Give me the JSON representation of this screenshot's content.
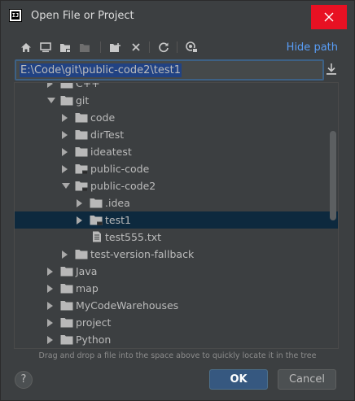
{
  "window": {
    "title": "Open File or Project",
    "app_icon_text": "IJ"
  },
  "toolbar": {
    "icons": [
      "home-icon",
      "desktop-icon",
      "project-folder-icon",
      "module-folder-icon",
      "new-folder-icon",
      "delete-icon",
      "refresh-icon",
      "show-hidden-icon"
    ],
    "hide_path_label": "Hide path"
  },
  "path_field": {
    "value": "E:\\Code\\git\\public-code2\\test1"
  },
  "tree": {
    "rows": [
      {
        "label": "C++",
        "expanded": false,
        "kind": "folder"
      },
      {
        "label": "git",
        "expanded": true,
        "kind": "folder"
      },
      {
        "label": "code",
        "expanded": false,
        "kind": "folder"
      },
      {
        "label": "dirTest",
        "expanded": false,
        "kind": "folder"
      },
      {
        "label": "ideatest",
        "expanded": false,
        "kind": "folder"
      },
      {
        "label": "public-code",
        "expanded": false,
        "kind": "module-folder"
      },
      {
        "label": "public-code2",
        "expanded": true,
        "kind": "module-folder"
      },
      {
        "label": ".idea",
        "expanded": false,
        "kind": "folder"
      },
      {
        "label": "test1",
        "expanded": false,
        "kind": "module-folder",
        "selected": true
      },
      {
        "label": "test555.txt",
        "kind": "file"
      },
      {
        "label": "test-version-fallback",
        "expanded": false,
        "kind": "folder"
      },
      {
        "label": "Java",
        "expanded": false,
        "kind": "folder"
      },
      {
        "label": "map",
        "expanded": false,
        "kind": "folder"
      },
      {
        "label": "MyCodeWarehouses",
        "expanded": false,
        "kind": "folder"
      },
      {
        "label": "project",
        "expanded": false,
        "kind": "folder"
      },
      {
        "label": "Python",
        "expanded": false,
        "kind": "folder"
      }
    ]
  },
  "hint": "Drag and drop a file into the space above to quickly locate it in the tree",
  "buttons": {
    "help": "?",
    "ok": "OK",
    "cancel": "Cancel"
  },
  "colors": {
    "accent_link": "#589df6",
    "selection": "#0d293e",
    "ok_button": "#365880",
    "close_button": "#e81123"
  }
}
